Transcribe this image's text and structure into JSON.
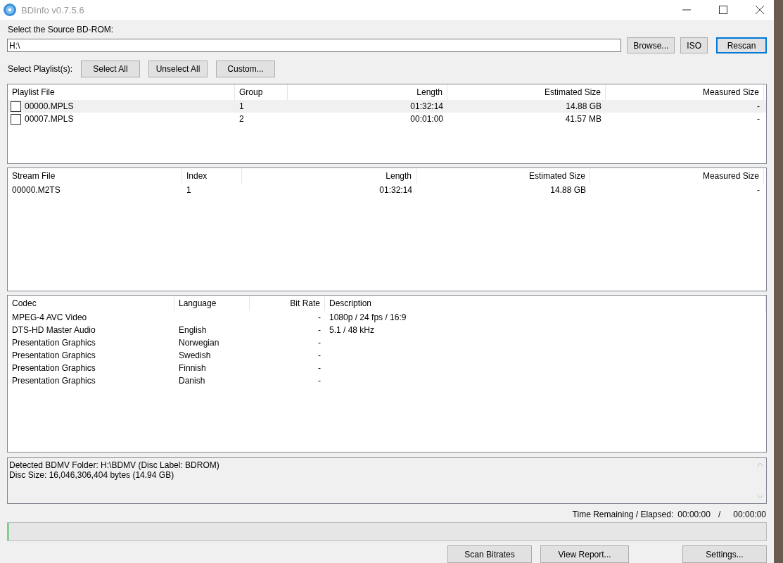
{
  "window": {
    "title": "BDInfo v0.7.5.6"
  },
  "source": {
    "label": "Select the Source BD-ROM:",
    "value": "H:\\",
    "buttons": [
      {
        "label": "Browse...",
        "focused": false
      },
      {
        "label": "ISO",
        "focused": false
      },
      {
        "label": "Rescan",
        "focused": true
      }
    ]
  },
  "playlist_select": {
    "label": "Select Playlist(s):",
    "buttons": [
      "Select All",
      "Unselect All",
      "Custom..."
    ]
  },
  "playlists": {
    "columns": [
      "Playlist File",
      "Group",
      "Length",
      "Estimated Size",
      "Measured Size"
    ],
    "rows": [
      {
        "file": "00000.MPLS",
        "checked": false,
        "selected": true,
        "group": "1",
        "length": "01:32:14",
        "estimated": "14.88 GB",
        "measured": "-"
      },
      {
        "file": "00007.MPLS",
        "checked": false,
        "selected": false,
        "group": "2",
        "length": "00:01:00",
        "estimated": "41.57 MB",
        "measured": "-"
      }
    ]
  },
  "streams": {
    "columns": [
      "Stream File",
      "Index",
      "Length",
      "Estimated Size",
      "Measured Size"
    ],
    "rows": [
      {
        "file": "00000.M2TS",
        "index": "1",
        "length": "01:32:14",
        "estimated": "14.88 GB",
        "measured": "-"
      }
    ]
  },
  "codecs": {
    "columns": [
      "Codec",
      "Language",
      "Bit Rate",
      "Description"
    ],
    "rows": [
      {
        "codec": "MPEG-4 AVC Video",
        "language": "",
        "bitrate": "-",
        "description": "1080p / 24 fps / 16:9"
      },
      {
        "codec": "DTS-HD Master Audio",
        "language": "English",
        "bitrate": "-",
        "description": "5.1 / 48 kHz"
      },
      {
        "codec": "Presentation Graphics",
        "language": "Norwegian",
        "bitrate": "-",
        "description": ""
      },
      {
        "codec": "Presentation Graphics",
        "language": "Swedish",
        "bitrate": "-",
        "description": ""
      },
      {
        "codec": "Presentation Graphics",
        "language": "Finnish",
        "bitrate": "-",
        "description": ""
      },
      {
        "codec": "Presentation Graphics",
        "language": "Danish",
        "bitrate": "-",
        "description": ""
      }
    ]
  },
  "log": [
    "Detected BDMV Folder: H:\\BDMV (Disc Label: BDROM)",
    "Disc Size: 16,046,306,404 bytes (14.94 GB)"
  ],
  "time": {
    "label": "Time Remaining / Elapsed:",
    "remaining": "00:00:00",
    "separator": "/",
    "elapsed": "00:00:00"
  },
  "progress": {
    "level": 0
  },
  "bottom_buttons": [
    "Scan Bitrates",
    "View Report...",
    "Settings..."
  ]
}
